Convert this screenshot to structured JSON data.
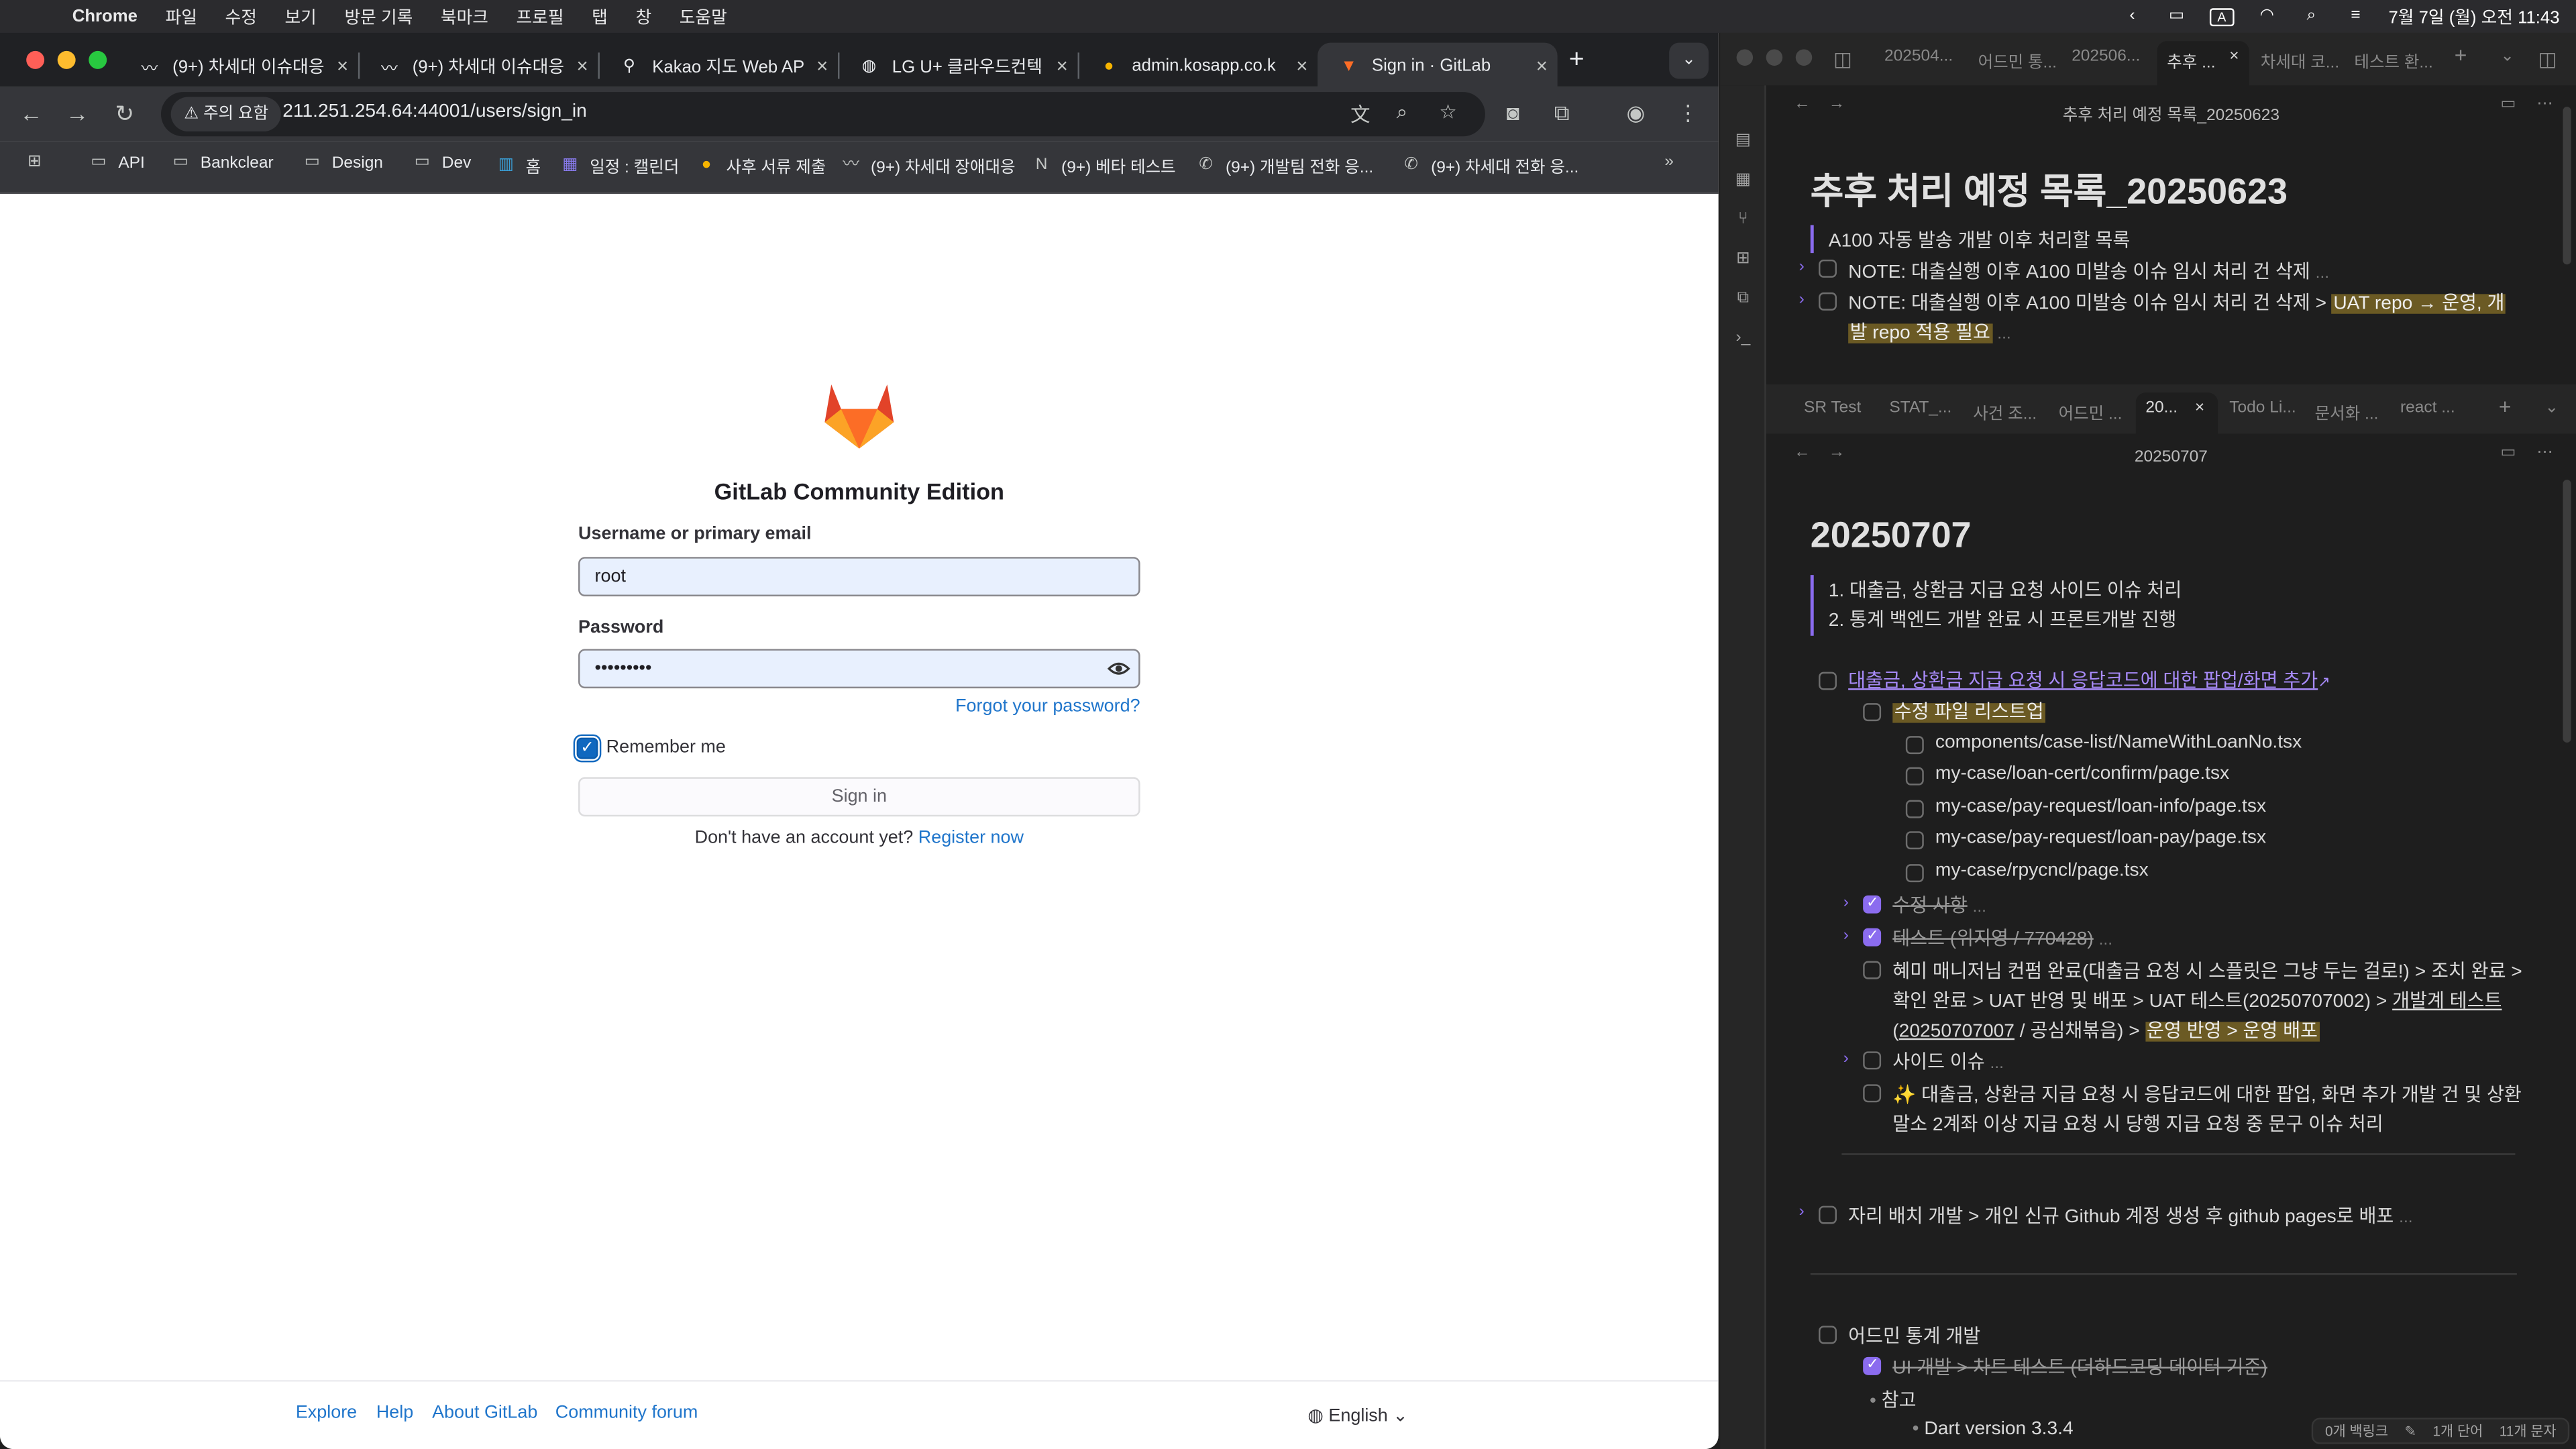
{
  "menubar": {
    "app": "Chrome",
    "items": [
      "파일",
      "수정",
      "보기",
      "방문 기록",
      "북마크",
      "프로필",
      "탭",
      "창",
      "도움말"
    ],
    "clock": "7월 7일 (월) 오전 11:43",
    "input_indicator": "A"
  },
  "browser": {
    "tabs": [
      {
        "title": "(9+) 차세대 이슈대응",
        "icon": "slack-swoosh-icon"
      },
      {
        "title": "(9+) 차세대 이슈대응",
        "icon": "slack-swoosh-icon"
      },
      {
        "title": "Kakao 지도 Web AP",
        "icon": "map-pin-icon"
      },
      {
        "title": "LG U+ 클라우드컨텍",
        "icon": "globe-icon"
      },
      {
        "title": "admin.kosapp.co.k",
        "icon": "kosapp-icon"
      },
      {
        "title": "Sign in · GitLab",
        "icon": "gitlab-icon",
        "active": true
      }
    ],
    "omnibox": {
      "security": "주의 요함",
      "url": "211.251.254.64:44001/users/sign_in"
    },
    "bookmarks": [
      {
        "label": "API",
        "icon": "folder-icon"
      },
      {
        "label": "Bankclear",
        "icon": "folder-icon"
      },
      {
        "label": "Design",
        "icon": "folder-icon"
      },
      {
        "label": "Dev",
        "icon": "folder-icon"
      },
      {
        "label": "홈",
        "icon": "dashboard-icon"
      },
      {
        "label": "일정 : 캘린더",
        "icon": "calendar-icon"
      },
      {
        "label": "사후 서류 제출",
        "icon": "kosapp-icon"
      },
      {
        "label": "(9+) 차세대 장애대응",
        "icon": "slack-swoosh-icon"
      },
      {
        "label": "(9+) 베타 테스트",
        "icon": "notion-icon"
      },
      {
        "label": "(9+) 개발팀 전화 응...",
        "icon": "phone-icon"
      },
      {
        "label": "(9+) 차세대 전화 응...",
        "icon": "phone-icon"
      }
    ]
  },
  "gitlab": {
    "title": "GitLab Community Edition",
    "username_label": "Username or primary email",
    "username_value": "root",
    "password_label": "Password",
    "password_value": "•••••••••",
    "forgot": "Forgot your password?",
    "remember": "Remember me",
    "sign_in": "Sign in",
    "no_account": "Don't have an account yet?",
    "register": "Register now",
    "footer": [
      "Explore",
      "Help",
      "About GitLab",
      "Community forum"
    ],
    "language": "English",
    "brand_colors": {
      "orange": "#e24329",
      "light_orange": "#fc6d26",
      "yellow": "#fca326"
    }
  },
  "obsidian": {
    "top_tabs": [
      "202504...",
      "어드민 통...",
      "202506...",
      "추후 ...",
      "차세대 코...",
      "테스트 환..."
    ],
    "top_title": "추후 처리 예정 목록_20250623",
    "top_h1": "추후 처리 예정 목록_20250623",
    "top_quote": "A100 자동 발송 개발 이후 처리할 목록",
    "top_item1": "NOTE: 대출실행 이후 A100 미발송 이슈 임시 처리 건 삭제",
    "top_item2_a": "NOTE: 대출실행 이후 A100 미발송 이슈 임시 처리 건 삭제 > ",
    "top_item2_b": "UAT repo → 운영, 개",
    "top_item2_c": "발 repo 적용 필요",
    "bottom_tabs": [
      "SR Test",
      "STAT_...",
      "사건 조...",
      "어드민 ...",
      "20...",
      "Todo Li...",
      "문서화 ...",
      "react ..."
    ],
    "bottom_title": "20250707",
    "bottom_h1": "20250707",
    "numbered": [
      "1. 대출금, 상환금 지급 요청 사이드 이슈 처리",
      "2. 통계 백엔드 개발 완료 시 프론트개발 진행"
    ],
    "task_link": "대출금, 상환금 지급 요청 시 응답코드에 대한 팝업/화면 추가",
    "file_list_title": "수정 파일 리스트업",
    "files": [
      "components/case-list/NameWithLoanNo.tsx",
      "my-case/loan-cert/confirm/page.tsx",
      "my-case/pay-request/loan-info/page.tsx",
      "my-case/pay-request/loan-pay/page.tsx",
      "my-case/rpycncl/page.tsx"
    ],
    "done1": "수정 사항",
    "done2": "테스트 (위지영 / 770428)",
    "long1_a": "혜미 매니저님 컨펌 완료(대출금 요청 시 스플릿은 그냥 두는 걸로!) > 조치 완료 >",
    "long1_b": "확인 완료 > UAT 반영 및 배포 > UAT 테스트(20250707002) > ",
    "long1_c": "개발계 테스트",
    "long1_d": "(",
    "long1_e": "20250707007",
    "long1_f": " / 공심채볶음) > ",
    "long1_g": "운영 반영 > 운영 배포",
    "side_issue": "사이드 이슈",
    "sparkle_a": "✨ 대출금, 상환금 지급 요청 시 응답코드에 대한 팝업, 화면 추가 개발 건 및 상환",
    "sparkle_b": "말소 2계좌 이상 지급 요청 시 당행 지급 요청 중 문구 이슈 처리",
    "seat_task": "자리 배치 개발 > 개인 신규 Github 계정 생성 후 github pages로 배포",
    "admin_stats": "어드민 통계 개발",
    "ui_dev": "UI 개발 > 차트 테스트 (더하드코딩 데이터 기준)",
    "ref": "참고",
    "dart": "Dart version 3.3.4",
    "status": [
      "0개 백링크",
      "1개 단어",
      "11개 문자"
    ],
    "accent": "#8b6cef"
  }
}
